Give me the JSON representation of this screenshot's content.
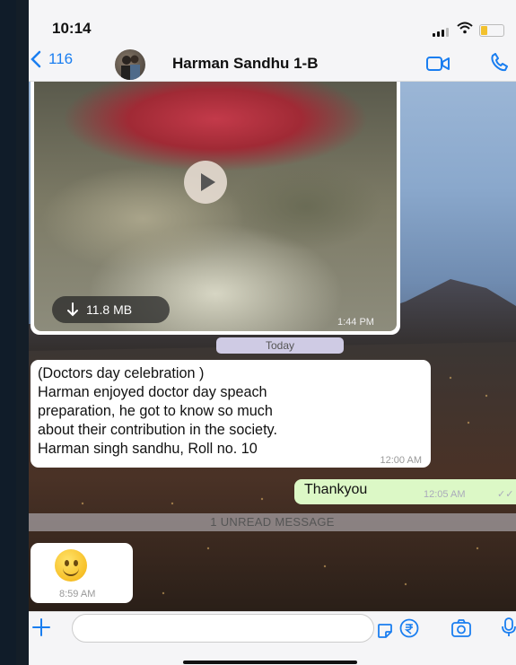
{
  "status_bar": {
    "time": "10:14"
  },
  "header": {
    "back_count": "116",
    "contact_name": "Harman Sandhu 1-B"
  },
  "messages": {
    "video": {
      "size": "11.8 MB",
      "time": "1:44 PM"
    },
    "date_divider": "Today",
    "text": {
      "lines": [
        "(Doctors day celebration )",
        "Harman enjoyed doctor day speach",
        "preparation, he got to know so much",
        "about their contribution in the society.",
        "Harman singh sandhu, Roll no. 10"
      ],
      "time": "12:00 AM"
    },
    "outgoing": {
      "text": "Thankyou",
      "time": "12:05 AM",
      "ticks": "✓✓"
    },
    "unread_banner": "1 UNREAD MESSAGE",
    "emoji": {
      "time": "8:59 AM"
    }
  },
  "colors": {
    "accent": "#1a7ef0",
    "outgoing_bubble": "#dcf8c6",
    "date_pill": "#cfcbe4"
  }
}
